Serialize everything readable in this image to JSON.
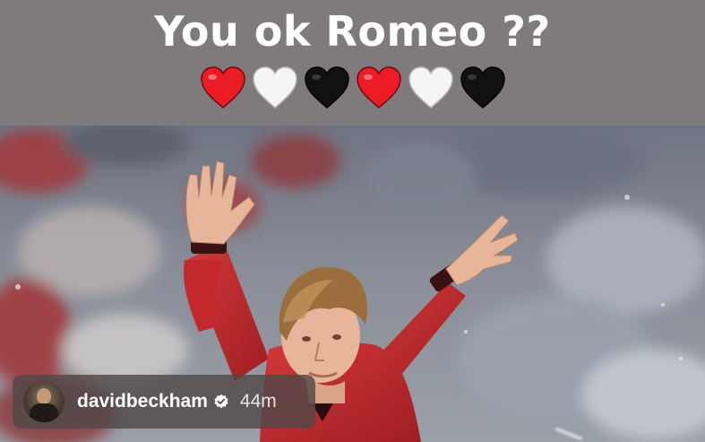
{
  "story": {
    "caption": "You ok Romeo ??",
    "emoji_sequence": [
      {
        "icon": "red-heart-icon",
        "color": "#ec1c24"
      },
      {
        "icon": "white-heart-icon",
        "color": "#f5f5f5"
      },
      {
        "icon": "black-heart-icon",
        "color": "#111111"
      },
      {
        "icon": "red-heart-icon",
        "color": "#ec1c24"
      },
      {
        "icon": "white-heart-icon",
        "color": "#f5f5f5"
      },
      {
        "icon": "black-heart-icon",
        "color": "#111111"
      }
    ],
    "photo": {
      "subject": "footballer-raising-arms",
      "jersey_color": "#c22a2e",
      "crowd_color": "#8a8f99"
    }
  },
  "author": {
    "username": "davidbeckham",
    "verified_icon": "verified-badge-icon",
    "posted_ago": "44m"
  }
}
